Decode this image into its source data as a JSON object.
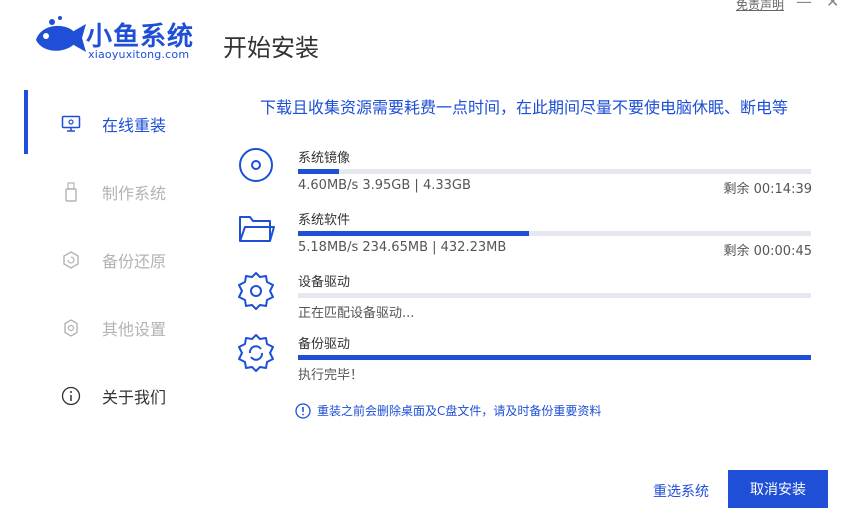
{
  "header": {
    "logo_text": "小鱼系统",
    "logo_sub": "xiaoyuxitong.com",
    "page_title": "开始安装",
    "disclaimer_link": "免责声明",
    "minimize_label": "—",
    "close_label": "✕"
  },
  "sidebar": {
    "items": [
      {
        "label": "在线重装",
        "icon": "monitor-icon",
        "state": "active"
      },
      {
        "label": "制作系统",
        "icon": "usb-icon",
        "state": "disabled"
      },
      {
        "label": "备份还原",
        "icon": "backup-icon",
        "state": "disabled"
      },
      {
        "label": "其他设置",
        "icon": "gear-icon",
        "state": "disabled"
      },
      {
        "label": "关于我们",
        "icon": "info-icon",
        "state": "normal"
      }
    ]
  },
  "main": {
    "notice": "下载且收集资源需要耗费一点时间，在此期间尽量不要使电脑休眠、断电等",
    "tasks": [
      {
        "title": "系统镜像",
        "icon": "disc-icon",
        "progress": 0.08,
        "stats": "4.60MB/s 3.95GB | 4.33GB",
        "remaining": "剩余 00:14:39"
      },
      {
        "title": "系统软件",
        "icon": "folder-icon",
        "progress": 0.45,
        "stats": "5.18MB/s 234.65MB | 432.23MB",
        "remaining": "剩余 00:00:45"
      },
      {
        "title": "设备驱动",
        "icon": "gear-icon",
        "progress": 0.0,
        "stats": "正在匹配设备驱动...",
        "remaining": ""
      },
      {
        "title": "备份驱动",
        "icon": "gear-refresh-icon",
        "progress": 1.0,
        "stats": "执行完毕！",
        "remaining": ""
      }
    ],
    "warning": "重装之前会删除桌面及C盘文件，请及时备份重要资料"
  },
  "footer": {
    "reselect_label": "重选系统",
    "cancel_label": "取消安装"
  },
  "colors": {
    "accent": "#1e4fd6",
    "track": "#e6e8ef",
    "disabled_text": "#b3b3b3"
  }
}
